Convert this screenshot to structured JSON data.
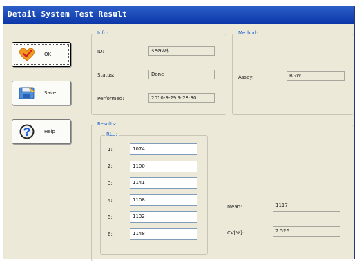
{
  "window": {
    "title": "Detail System Test Result"
  },
  "buttons": {
    "ok": {
      "label": "OK",
      "icon": "heart-check-icon"
    },
    "save": {
      "label": "Save",
      "icon": "save-icon"
    },
    "help": {
      "label": "Help",
      "icon": "help-icon"
    }
  },
  "info": {
    "legend": "Info:",
    "id_label": "ID:",
    "id_value": "$BGW$",
    "status_label": "Status:",
    "status_value": "Done",
    "performed_label": "Performed:",
    "performed_value": "2010-3-29 9:28:30"
  },
  "method": {
    "legend": "Method:",
    "assay_label": "Assay:",
    "assay_value": "BGW"
  },
  "results": {
    "legend": "Results:",
    "rlu_legend": "RLU:",
    "rows": [
      {
        "label": "1:",
        "value": "1074"
      },
      {
        "label": "2:",
        "value": "1100"
      },
      {
        "label": "3:",
        "value": "1141"
      },
      {
        "label": "4:",
        "value": "1108"
      },
      {
        "label": "5:",
        "value": "1132"
      },
      {
        "label": "6:",
        "value": "1148"
      }
    ],
    "mean_label": "Mean:",
    "mean_value": "1117",
    "cv_label": "CV[%]:",
    "cv_value": "2.526"
  },
  "colors": {
    "title_bar": "#0b36a8",
    "legend_text": "#1a5fd0",
    "window_bg": "#ece9d8"
  }
}
